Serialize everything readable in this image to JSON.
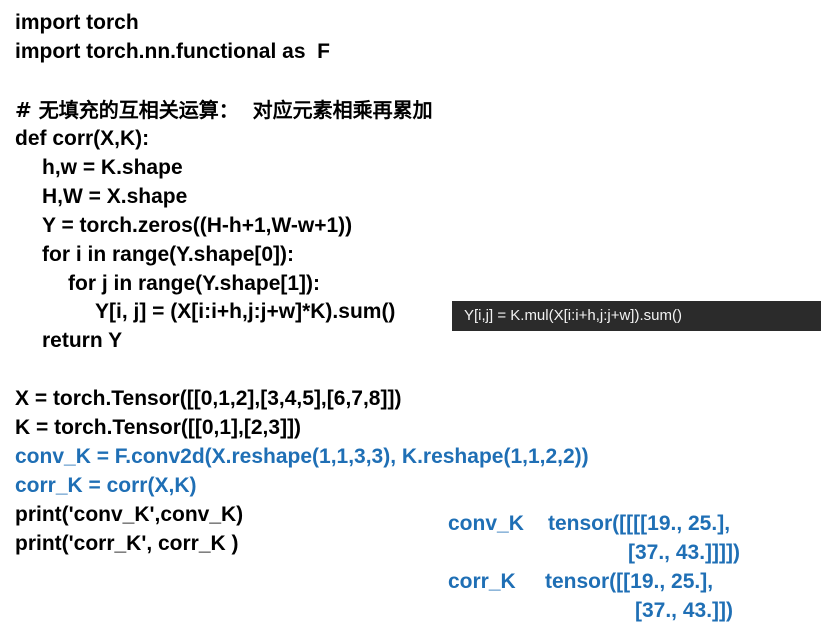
{
  "code": {
    "line1": "import torch",
    "line2": "import torch.nn.functional as  F",
    "comment": "# 无填充的互相关运算：  对应元素相乘再累加",
    "def": "def corr(X,K):",
    "hw": "h,w = K.shape",
    "HW": "H,W = X.shape",
    "Y": "Y = torch.zeros((H-h+1,W-w+1))",
    "for_i": "for i in range(Y.shape[0]):",
    "for_j": "for j in range(Y.shape[1]):",
    "assign": "Y[i, j] = (X[i:i+h,j:j+w]*K).sum()",
    "ret": "return Y",
    "X_def": "X = torch.Tensor([[0,1,2],[3,4,5],[6,7,8]])",
    "K_def": "K = torch.Tensor([[0,1],[2,3]])",
    "conv_k": "conv_K = F.conv2d(X.reshape(1,1,3,3), K.reshape(1,1,2,2))",
    "corr_k": "corr_K = corr(X,K)",
    "print1": "print('conv_K',conv_K)",
    "print2": "print('corr_K', corr_K )"
  },
  "tooltip": {
    "text": "Y[i,j] = K.mul(X[i:i+h,j:j+w]).sum()"
  },
  "output": {
    "conv_label": "conv_K",
    "conv_line1": "tensor([[[[19., 25.],",
    "conv_line2": "[37., 43.]]]])",
    "corr_label": "corr_K",
    "corr_line1": "tensor([[19., 25.],",
    "corr_line2": "[37., 43.]])"
  },
  "colors": {
    "code": "#000000",
    "highlight": "#1f6fb5",
    "tooltip_bg": "#2b2b2b",
    "tooltip_text": "#f2f2f2"
  }
}
